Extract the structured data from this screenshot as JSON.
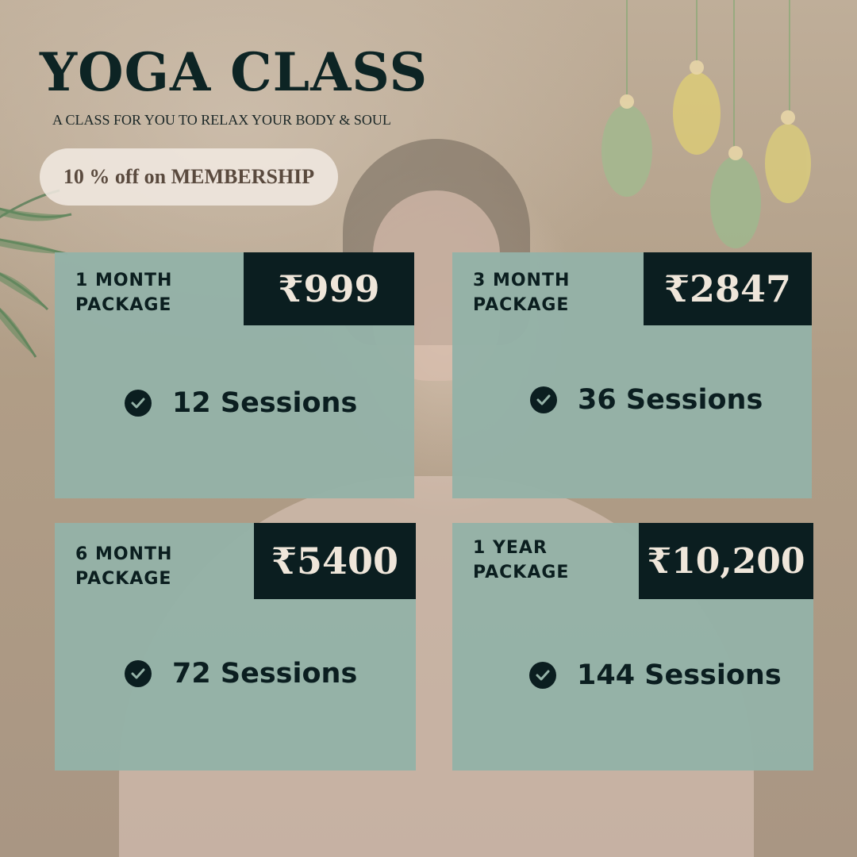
{
  "header": {
    "title": "YOGA CLASS",
    "subtitle": "A CLASS FOR YOU TO RELAX YOUR BODY & SOUL",
    "badge": "10 % off on MEMBERSHIP"
  },
  "packages": [
    {
      "label_line1": "1 MONTH",
      "label_line2": "PACKAGE",
      "price": "₹999",
      "sessions": "12 Sessions"
    },
    {
      "label_line1": "3 MONTH",
      "label_line2": "PACKAGE",
      "price": "₹2847",
      "sessions": "36 Sessions"
    },
    {
      "label_line1": "6 MONTH",
      "label_line2": "PACKAGE",
      "price": "₹5400",
      "sessions": "72 Sessions"
    },
    {
      "label_line1": "1 YEAR",
      "label_line2": "PACKAGE",
      "price": "₹10,200",
      "sessions": "144 Sessions"
    }
  ],
  "icons": {
    "session_check": "check-circle-icon",
    "palm": "palm-leaf-icon",
    "hanging_decor": "hanging-leaf-icon"
  },
  "colors": {
    "card": "#94b2a7",
    "price_box": "#0b1e20",
    "price_text": "#efe6da",
    "title": "#0d2424"
  }
}
